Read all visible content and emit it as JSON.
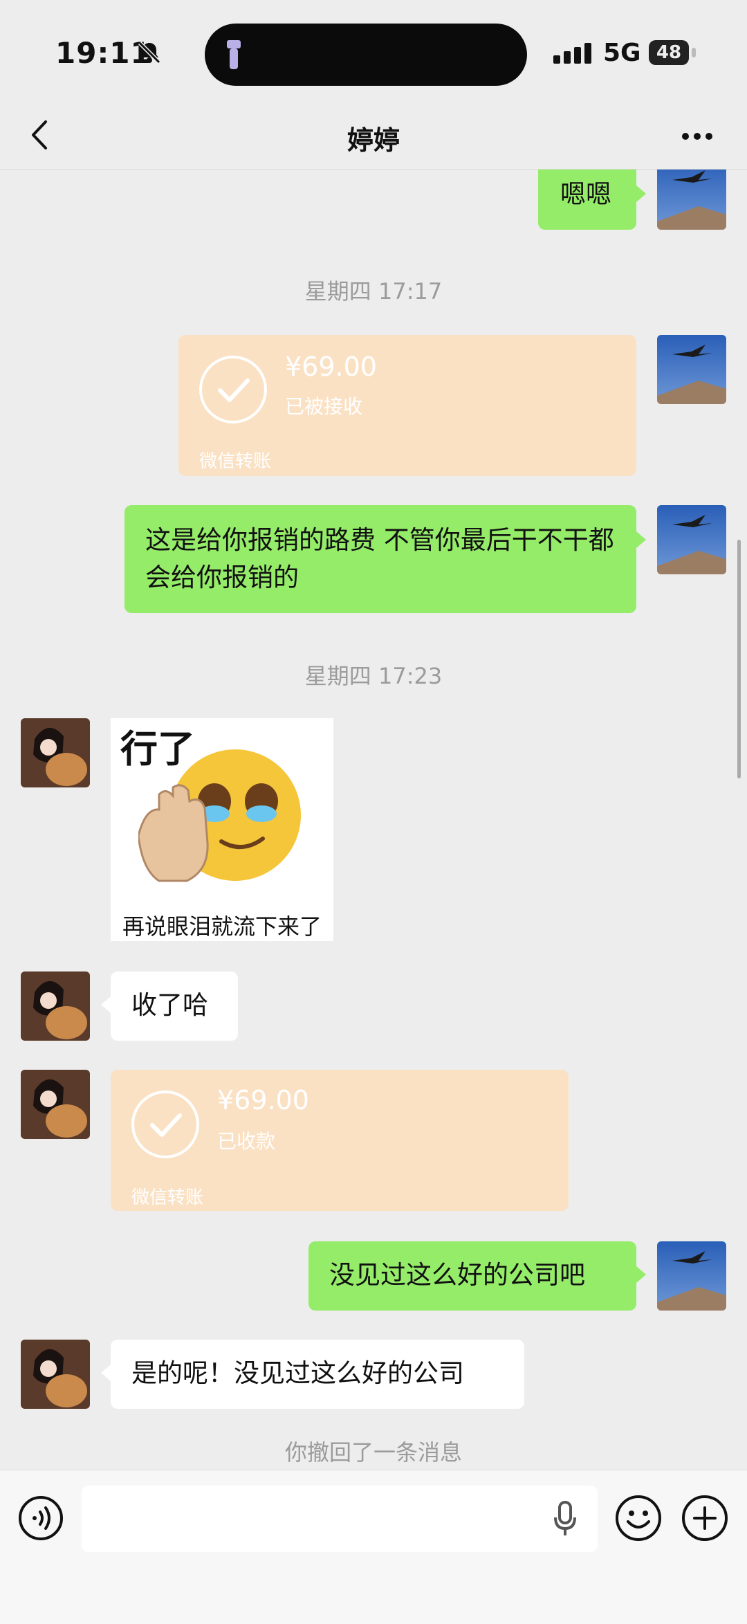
{
  "status_bar": {
    "time": "19:11",
    "network": "5G",
    "battery": "48"
  },
  "nav": {
    "title": "婷婷"
  },
  "messages": {
    "msg1": "嗯嗯",
    "ts1": "星期四 17:17",
    "transfer1": {
      "amount": "¥69.00",
      "status": "已被接收",
      "label": "微信转账"
    },
    "msg2": "这是给你报销的路费  不管你最后干不干都会给你报销的",
    "ts2": "星期四 17:23",
    "sticker": {
      "top": "行了",
      "bottom": "再说眼泪就流下来了"
    },
    "msg3": "收了哈",
    "transfer2": {
      "amount": "¥69.00",
      "status": "已收款",
      "label": "微信转账"
    },
    "msg4": "没见过这么好的公司吧",
    "msg5": "是的呢！没见过这么好的公司",
    "recall": "你撤回了一条消息"
  },
  "input": {
    "placeholder": ""
  },
  "colors": {
    "bubble_green": "#95ec69",
    "transfer_bg": "#fbe1c4",
    "background": "#ededed"
  }
}
